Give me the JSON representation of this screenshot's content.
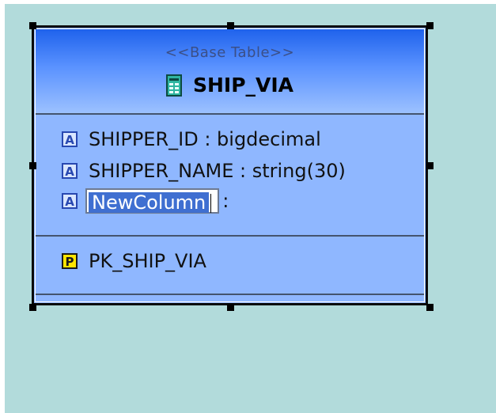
{
  "entity": {
    "stereotype": "<<Base Table>>",
    "name": "SHIP_VIA",
    "icon": "table-icon",
    "columns": [
      {
        "badge": "A",
        "label": "SHIPPER_ID : bigdecimal"
      },
      {
        "badge": "A",
        "label": "SHIPPER_NAME : string(30)"
      }
    ],
    "editing_column": {
      "badge": "A",
      "value": "NewColumn",
      "suffix": ":"
    },
    "keys": [
      {
        "badge": "P",
        "label": "PK_SHIP_VIA"
      }
    ]
  },
  "colors": {
    "canvas": "#b2dbdb",
    "entity_fill": "#8fb7ff",
    "header_top": "#1f62ec",
    "header_bottom": "#9cc1ff",
    "selection_text_bg": "#3f6fd1",
    "primary_key_badge": "#ffe600"
  }
}
